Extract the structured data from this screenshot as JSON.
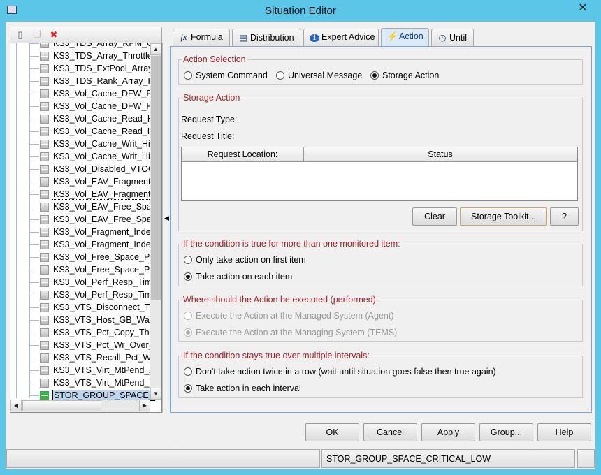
{
  "window": {
    "title": "Situation Editor",
    "close": "✕"
  },
  "left_toolbar": {
    "icons": [
      "new-situation-icon",
      "copy-situation-icon",
      "delete-situation-icon"
    ]
  },
  "tree": {
    "items": [
      "KS3_TDS_Array_RPM_O",
      "KS3_TDS_Array_Throttled",
      "KS3_TDS_ExtPool_Array_",
      "KS3_TDS_Rank_Array_P",
      "KS3_Vol_Cache_DFW_R",
      "KS3_Vol_Cache_DFW_R",
      "KS3_Vol_Cache_Read_H",
      "KS3_Vol_Cache_Read_H",
      "KS3_Vol_Cache_Writ_Hit",
      "KS3_Vol_Cache_Writ_Hit",
      "KS3_Vol_Disabled_VTOC",
      "KS3_Vol_EAV_Fragment_",
      "KS3_Vol_EAV_Fragment_",
      "KS3_Vol_EAV_Free_Spac",
      "KS3_Vol_EAV_Free_Spac",
      "KS3_Vol_Fragment_Inde",
      "KS3_Vol_Fragment_Inde",
      "KS3_Vol_Free_Space_Po",
      "KS3_Vol_Free_Space_Po",
      "KS3_Vol_Perf_Resp_Tim",
      "KS3_Vol_Perf_Resp_Tim",
      "KS3_VTS_Disconnect_Ti",
      "KS3_VTS_Host_GB_War",
      "KS3_VTS_Pct_Copy_Thro",
      "KS3_VTS_Pct_Wr_Over_",
      "KS3_VTS_Recall_Pct_Wa",
      "KS3_VTS_Virt_MtPend_A",
      "KS3_VTS_Virt_MtPend_M",
      "STOR_GROUP_SPACE_"
    ],
    "selected": "STOR_GROUP_SPACE_",
    "focused_index": 12
  },
  "tabs": [
    {
      "label": "Formula",
      "icon": "fx"
    },
    {
      "label": "Distribution",
      "icon": "▤"
    },
    {
      "label": "Expert Advice",
      "icon": "ℹ"
    },
    {
      "label": "Action",
      "icon": "⚡",
      "active": true
    },
    {
      "label": "Until",
      "icon": "◷"
    }
  ],
  "action_selection": {
    "legend": "Action Selection",
    "options": [
      "System Command",
      "Universal Message",
      "Storage Action"
    ],
    "selected": "Storage Action"
  },
  "storage_action": {
    "legend": "Storage Action",
    "request_type_label": "Request Type:",
    "request_title_label": "Request Title:",
    "columns": [
      "Request Location:",
      "Status"
    ],
    "rows": [],
    "buttons": {
      "clear": "Clear",
      "toolkit": "Storage Toolkit...",
      "help": "?"
    }
  },
  "multi_item": {
    "legend": "If the condition is true for more than one monitored item:",
    "options": [
      "Only take action on first item",
      "Take action on each item"
    ],
    "selected": "Take action on each item"
  },
  "execute_where": {
    "legend": "Where should the Action be executed (performed):",
    "options": [
      "Execute the Action at the Managed System (Agent)",
      "Execute the Action at the Managing System (TEMS)"
    ],
    "selected": "Execute the Action at the Managing System (TEMS)",
    "disabled": true
  },
  "intervals": {
    "legend": "If the condition stays true over multiple intervals:",
    "options": [
      "Don't take action twice in a row (wait until situation goes false then true again)",
      "Take action in each interval"
    ],
    "selected": "Take action in each interval"
  },
  "buttons": {
    "ok": "OK",
    "cancel": "Cancel",
    "apply": "Apply",
    "group": "Group...",
    "help": "Help"
  },
  "status": {
    "left": "",
    "center": "STOR_GROUP_SPACE_CRITICAL_LOW",
    "right": ""
  },
  "colors": {
    "titlebar": "#5cc6e8",
    "legend": "#a0222a",
    "selection": "#bcd6ee"
  }
}
